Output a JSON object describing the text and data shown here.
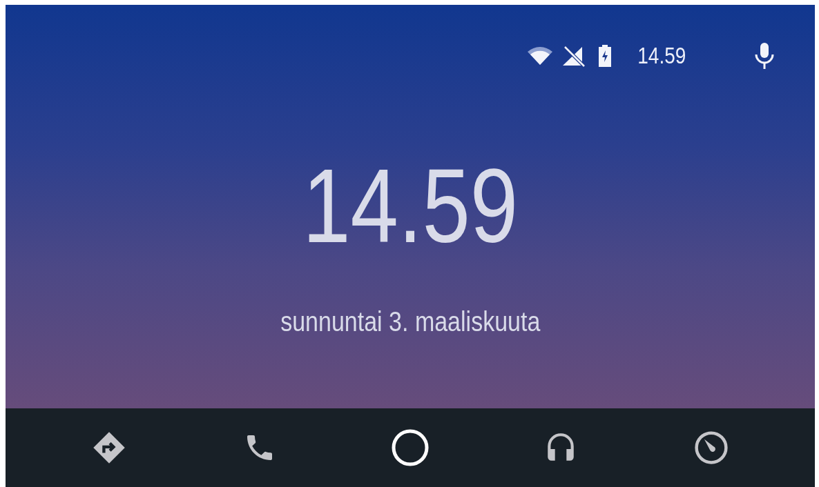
{
  "status_bar": {
    "time": "14.59"
  },
  "clock": {
    "time": "14.59",
    "date": "sunnuntai 3. maaliskuuta"
  },
  "nav_bar": [
    {
      "kind": "directions",
      "selected": false
    },
    {
      "kind": "phone",
      "selected": false
    },
    {
      "kind": "home",
      "selected": true
    },
    {
      "kind": "music",
      "selected": false
    },
    {
      "kind": "overview",
      "selected": false
    }
  ]
}
